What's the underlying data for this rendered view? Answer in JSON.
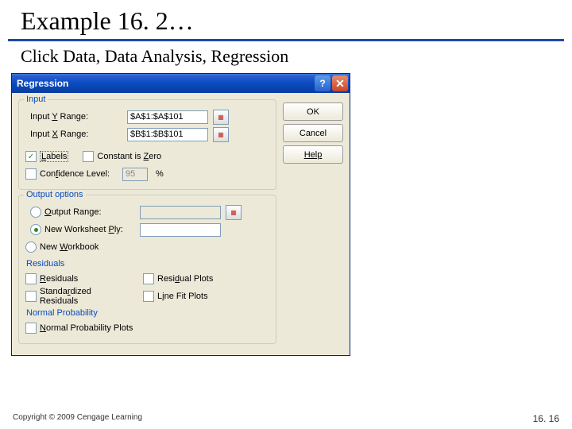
{
  "slide": {
    "title": "Example 16. 2…",
    "instruction": "Click Data, Data Analysis, Regression"
  },
  "dialog": {
    "title": "Regression",
    "buttons": {
      "ok": "OK",
      "cancel": "Cancel",
      "help": "Help"
    },
    "input": {
      "group": "Input",
      "y_label_pre": "Input ",
      "y_label_u": "Y",
      "y_label_post": " Range:",
      "y_value": "$A$1:$A$101",
      "x_label_pre": "Input ",
      "x_label_u": "X",
      "x_label_post": " Range:",
      "x_value": "$B$1:$B$101",
      "labels_u": "L",
      "labels_post": "abels",
      "zero_pre": "Constant is ",
      "zero_u": "Z",
      "zero_post": "ero",
      "conf_pre": "Con",
      "conf_u": "f",
      "conf_post": "idence Level:",
      "conf_value": "95",
      "conf_pct": "%"
    },
    "output": {
      "group": "Output options",
      "range_u": "O",
      "range_post": "utput Range:",
      "ws_pre": "New Worksheet ",
      "ws_u": "P",
      "ws_post": "ly:",
      "wb_pre": "New ",
      "wb_u": "W",
      "wb_post": "orkbook"
    },
    "residuals": {
      "group": "Residuals",
      "res_u": "R",
      "res_post": "esiduals",
      "std_pre": "Standa",
      "std_u": "r",
      "std_post": "dized Residuals",
      "plots_pre": "Resi",
      "plots_u": "d",
      "plots_post": "ual Plots",
      "line_pre": "L",
      "line_u": "i",
      "line_post": "ne Fit Plots"
    },
    "normal": {
      "group": "Normal Probability",
      "np_u": "N",
      "np_post": "ormal Probability Plots"
    }
  },
  "footer": {
    "copyright": "Copyright © 2009 Cengage Learning",
    "page": "16. 16"
  }
}
